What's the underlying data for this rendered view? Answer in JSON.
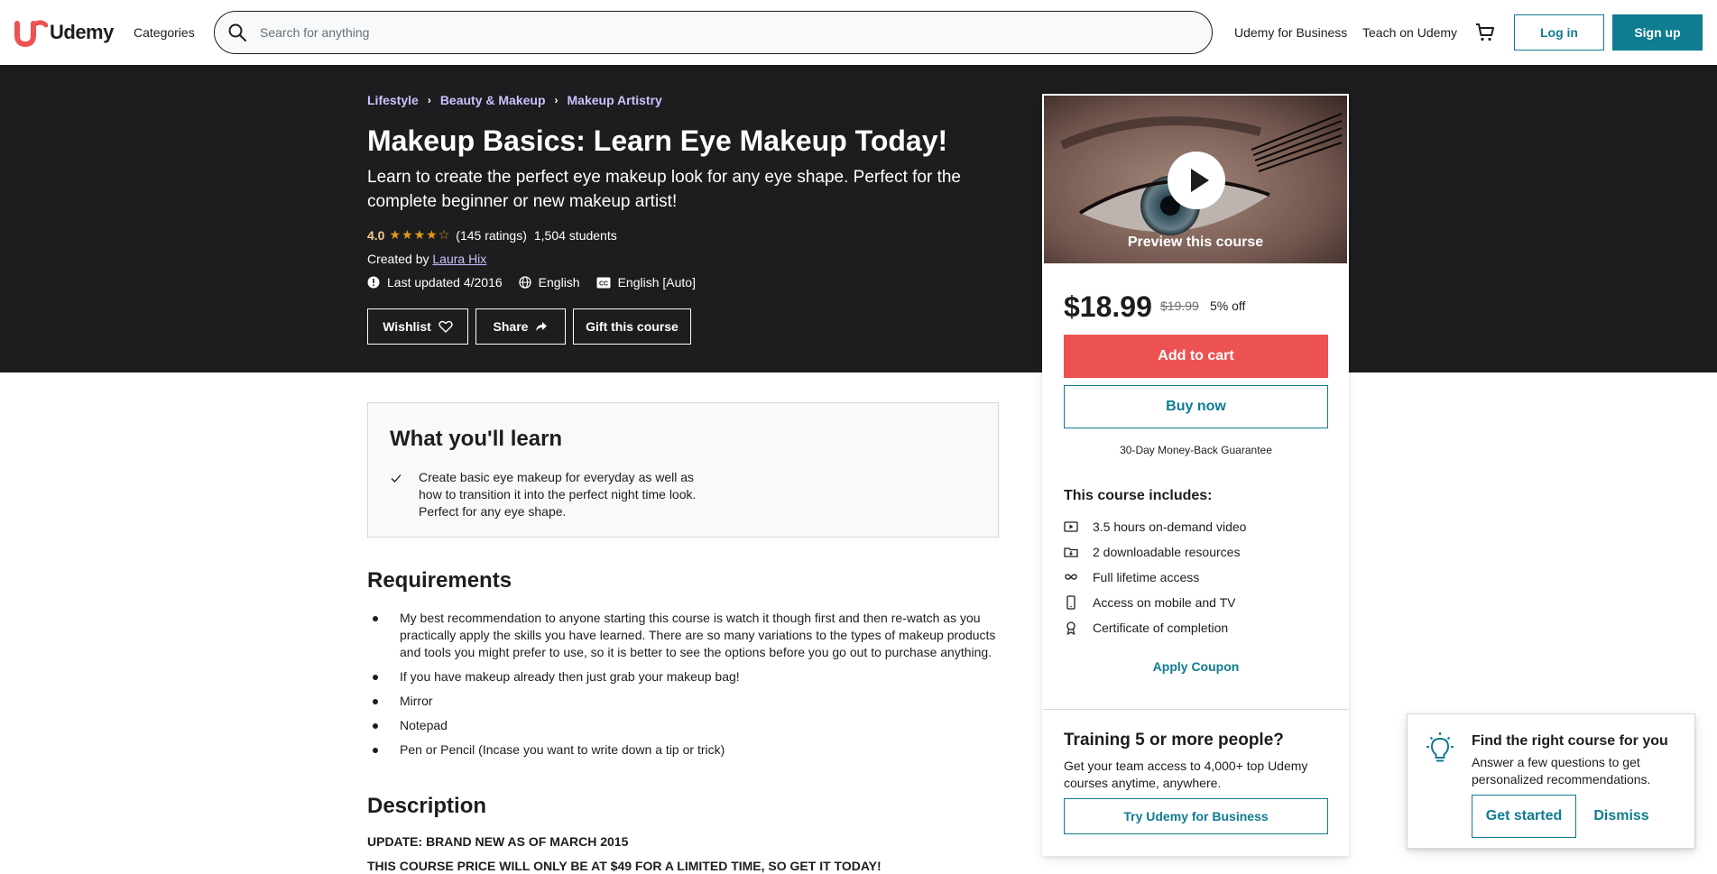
{
  "colors": {
    "brand": "#ec5252",
    "accent": "#0f7c90",
    "dark": "#1c1d1f",
    "link_light": "#cec0fc",
    "star": "#e59819",
    "cart_button": "#ec5252"
  },
  "header": {
    "logo_text": "Udemy",
    "categories": "Categories",
    "search_placeholder": "Search for anything",
    "business_link": "Udemy for Business",
    "teach_link": "Teach on Udemy",
    "login": "Log in",
    "signup": "Sign up"
  },
  "course": {
    "breadcrumbs": [
      "Lifestyle",
      "Beauty & Makeup",
      "Makeup Artistry"
    ],
    "title": "Makeup Basics: Learn Eye Makeup Today!",
    "subtitle": "Learn to create the perfect eye makeup look for any eye shape. Perfect for the complete beginner or new makeup artist!",
    "rating": "4.0",
    "star_rating": 4.0,
    "ratings_count": "(145 ratings)",
    "students": "1,504 students",
    "created_by_label": "Created by",
    "instructor": "Laura Hix",
    "last_updated": "Last updated 4/2016",
    "language": "English",
    "captions": "English [Auto]",
    "wishlist": "Wishlist",
    "share": "Share",
    "gift": "Gift this course"
  },
  "sidebar": {
    "preview_label": "Preview this course",
    "price": "$18.99",
    "original_price": "$19.99",
    "discount": "5% off",
    "add_to_cart": "Add to cart",
    "buy_now": "Buy now",
    "guarantee": "30-Day Money-Back Guarantee",
    "includes_title": "This course includes:",
    "includes": [
      {
        "icon": "video-icon",
        "text": "3.5 hours on-demand video"
      },
      {
        "icon": "file-download-icon",
        "text": "2 downloadable resources"
      },
      {
        "icon": "infinity-icon",
        "text": "Full lifetime access"
      },
      {
        "icon": "mobile-icon",
        "text": "Access on mobile and TV"
      },
      {
        "icon": "certificate-icon",
        "text": "Certificate of completion"
      }
    ],
    "apply_coupon": "Apply Coupon",
    "training_title": "Training 5 or more people?",
    "training_text": "Get your team access to 4,000+ top Udemy courses anytime, anywhere.",
    "try_business": "Try Udemy for Business"
  },
  "learn": {
    "title": "What you'll learn",
    "items": [
      "Create basic eye makeup for everyday as well as how to transition it into the perfect night time look. Perfect for any eye shape."
    ]
  },
  "requirements": {
    "title": "Requirements",
    "items": [
      "My best recommendation to anyone starting this course is watch it though first and then re-watch as you practically apply the skills you have learned. There are so many variations to the types of makeup products and tools you might prefer to use, so it is better to see the options before you go out to purchase anything.",
      "If you have makeup already then just grab your makeup bag!",
      "Mirror",
      "Notepad",
      "Pen or Pencil (Incase you want to write down a tip or trick)"
    ]
  },
  "description": {
    "title": "Description",
    "line1": "UPDATE: BRAND NEW AS OF MARCH 2015",
    "line2": "THIS COURSE PRICE WILL ONLY BE AT $49 FOR A LIMITED TIME, SO GET IT TODAY!"
  },
  "popup": {
    "title": "Find the right course for you",
    "text": "Answer a few questions to get personalized recommendations.",
    "get_started": "Get started",
    "dismiss": "Dismiss"
  }
}
